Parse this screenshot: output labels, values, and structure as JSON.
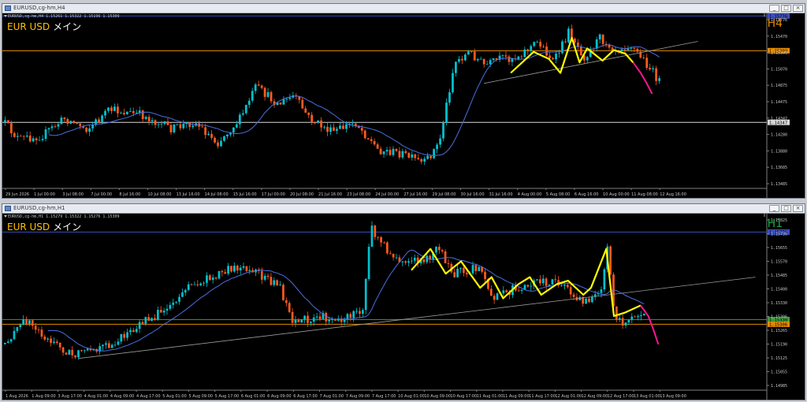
{
  "windows": [
    {
      "title": "EURUSD,cg-hm,H4",
      "ohlc_line": "EURUSD,cg-hm,H4  1.15261 1.15322 1.15196 1.15309",
      "symbol": "EUR USD",
      "symbol_suffix": "メイン",
      "timeframe": "H4",
      "timeframe_color": "#e38b00",
      "buttons": [
        "_",
        "□",
        "×"
      ]
    },
    {
      "title": "EURUSD,cg-hm,H1",
      "ohlc_line": "EURUSD,cg-hm,H1  1.15279 1.15322 1.15276 1.15309",
      "symbol": "EUR USD",
      "symbol_suffix": "メイン",
      "timeframe": "H1",
      "timeframe_color": "#19a84c",
      "buttons": [
        "_",
        "□",
        "×"
      ]
    }
  ],
  "chart_data": [
    {
      "type": "candlestick",
      "timeframe": "H4",
      "colors": {
        "up": "#00c2cf",
        "down": "#ff5a1f",
        "ma": "#4a6fe0",
        "zigzag": "#ffff00",
        "forecast": "#ff1493",
        "trendline": "#9a9a9a"
      },
      "y_ticks": [
        "1.15776",
        "1.15470",
        "1.15309",
        "1.15070",
        "1.14875",
        "1.14475",
        "1.14347",
        "1.14280",
        "1.13880",
        "1.13685",
        "1.13485"
      ],
      "ylim": [
        1.1346,
        1.1581
      ],
      "x_ticks": [
        "29 Jun 2026",
        "1 Jul 00:00",
        "3 Jul 08:00",
        "7 Jul 00:00",
        "8 Jul 16:00",
        "10 Jul 08:00",
        "13 Jul 16:00",
        "14 Jul 08:00",
        "15 Jul 16:00",
        "17 Jul 00:00",
        "20 Jul 08:00",
        "21 Jul 16:00",
        "23 Jul 08:00",
        "24 Jul 00:00",
        "27 Jul 16:00",
        "29 Jul 08:00",
        "30 Jul 16:00",
        "31 Jul 16:00",
        "4 Aug 00:00",
        "5 Aug 08:00",
        "6 Aug 16:00",
        "10 Aug 00:00",
        "11 Aug 08:00",
        "12 Aug 16:00"
      ],
      "hlines": [
        {
          "price": 1.15776,
          "color": "#3a4fbf",
          "label": "1.15776"
        },
        {
          "price": 1.15309,
          "color": "#e38b00",
          "label": "1.15309"
        },
        {
          "price": 1.14347,
          "color": "#d8d8d8",
          "label": "1.14347"
        }
      ],
      "ma_close_length": 14
    },
    {
      "type": "candlestick",
      "timeframe": "H1",
      "colors": {
        "up": "#00c2cf",
        "down": "#ff5a1f",
        "ma": "#4a6fe0",
        "zigzag": "#ffff00",
        "forecast": "#ff1493",
        "trendline": "#9a9a9a"
      },
      "y_ticks": [
        "1.15825",
        "1.15735",
        "1.15655",
        "1.15570",
        "1.15485",
        "1.15400",
        "1.15330",
        "1.15306",
        "1.15265",
        "1.15190",
        "1.15125",
        "1.15055",
        "1.14985"
      ],
      "ylim": [
        1.1497,
        1.1587
      ],
      "x_ticks": [
        "1 Aug 2026",
        "1 Aug 09:00",
        "3 Aug 17:00",
        "4 Aug 01:00",
        "4 Aug 09:00",
        "4 Aug 17:00",
        "5 Aug 01:00",
        "5 Aug 09:00",
        "5 Aug 17:00",
        "6 Aug 01:00",
        "6 Aug 09:00",
        "6 Aug 17:00",
        "7 Aug 01:00",
        "7 Aug 09:00",
        "7 Aug 17:00",
        "10 Aug 01:00",
        "10 Aug 09:00",
        "10 Aug 17:00",
        "11 Aug 01:00",
        "11 Aug 09:00",
        "11 Aug 17:00",
        "12 Aug 01:00",
        "12 Aug 09:00",
        "12 Aug 17:00",
        "13 Aug 01:00",
        "13 Aug 09:00"
      ],
      "hlines": [
        {
          "price": 1.15776,
          "color": "#3a4fbf",
          "label": "1.15776"
        },
        {
          "price": 1.1533,
          "color": "#3a9e3a",
          "label": "1.15330"
        },
        {
          "price": 1.15306,
          "color": "#e38b00",
          "label": "1.15306"
        }
      ],
      "ma_close_length": 14
    }
  ]
}
